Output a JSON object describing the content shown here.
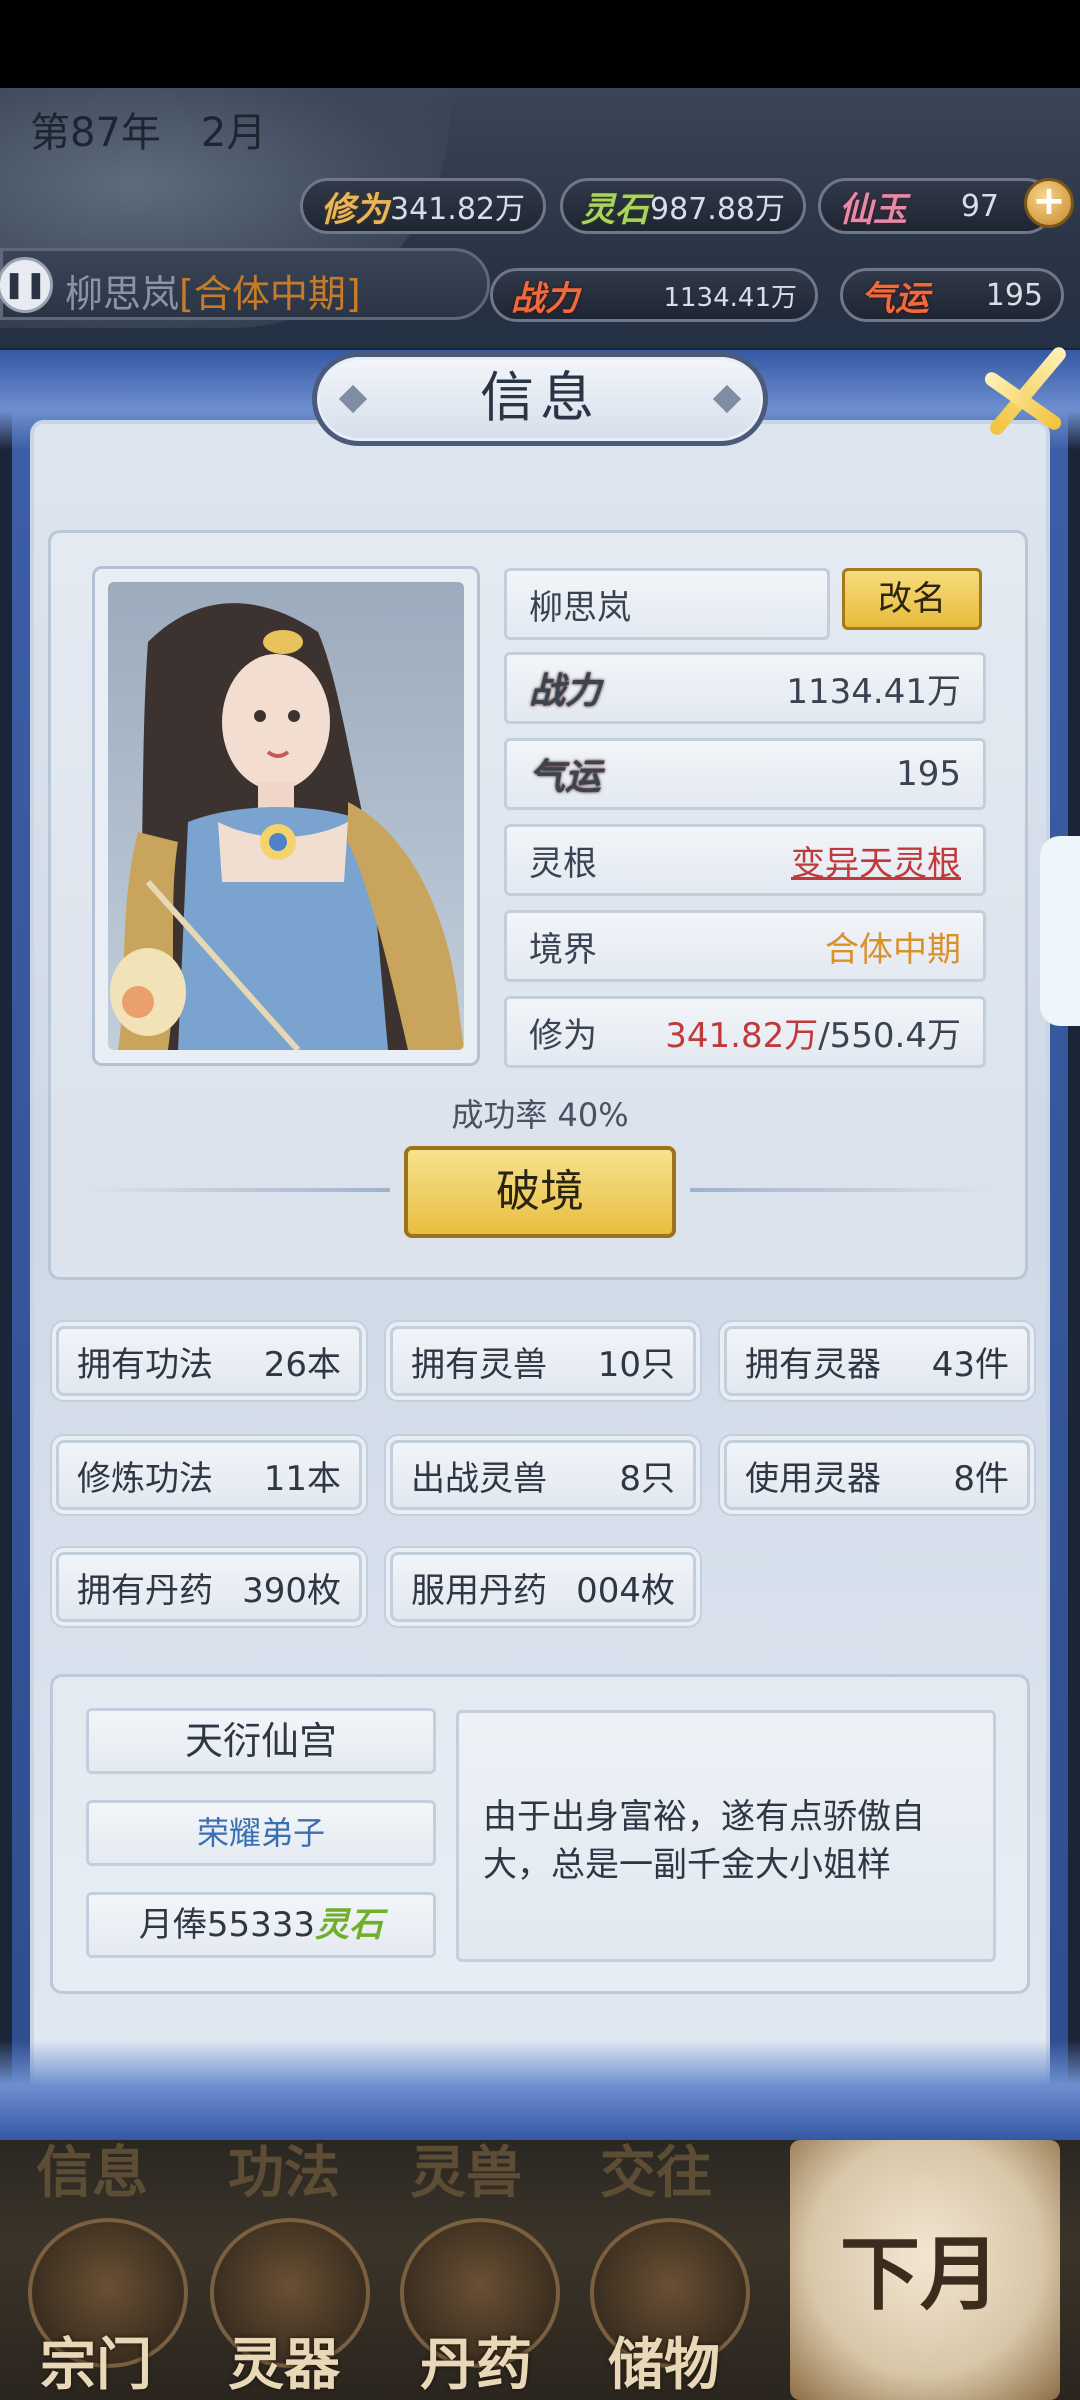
{
  "hud": {
    "year": "第87年",
    "month": "2月",
    "cultivation_tag": "修为",
    "cultivation_value": "341.82万",
    "spirit_stone_tag": "灵石",
    "spirit_stone_value": "987.88万",
    "jade_tag": "仙玉",
    "jade_value": "97",
    "plus": "+",
    "power_tag": "战力",
    "power_value": "1134.41万",
    "luck_tag": "气运",
    "luck_value": "195",
    "character_name": "柳思岚",
    "character_realm": "[合体中期]",
    "pause_icon": "pause-icon"
  },
  "panel": {
    "title": "信息",
    "name": "柳思岚",
    "rename": "改名",
    "power_label": "战力",
    "power_value": "1134.41万",
    "luck_label": "气运",
    "luck_value": "195",
    "root_label": "灵根",
    "root_value": "变异天灵根",
    "realm_label": "境界",
    "realm_value": "合体中期",
    "cult_label": "修为",
    "cult_current": "341.82万",
    "cult_max": "/550.4万",
    "success_rate": "成功率 40%",
    "breakthrough": "破境"
  },
  "stats": [
    {
      "label": "拥有功法",
      "value": "26本"
    },
    {
      "label": "拥有灵兽",
      "value": "10只"
    },
    {
      "label": "拥有灵器",
      "value": "43件"
    },
    {
      "label": "修炼功法",
      "value": "11本"
    },
    {
      "label": "出战灵兽",
      "value": "8只"
    },
    {
      "label": "使用灵器",
      "value": "8件"
    },
    {
      "label": "拥有丹药",
      "value": "390枚"
    },
    {
      "label": "服用丹药",
      "value": "004枚"
    }
  ],
  "sect": {
    "name": "天衍仙宫",
    "rank": "荣耀弟子",
    "salary_prefix": "月俸55333",
    "salary_unit": "灵石",
    "description": "由于出身富裕，遂有点骄傲自大，总是一副千金大小姐样"
  },
  "bottom_menu": {
    "tabs": [
      "信息",
      "功法",
      "灵兽",
      "交往"
    ],
    "items": [
      "宗门",
      "灵器",
      "丹药",
      "储物"
    ],
    "next": "下月"
  },
  "colors": {
    "accent_gold": "#e8be3f",
    "frame_blue": "#3558a5",
    "root_red": "#c0393b",
    "realm_orange": "#d9922a"
  }
}
